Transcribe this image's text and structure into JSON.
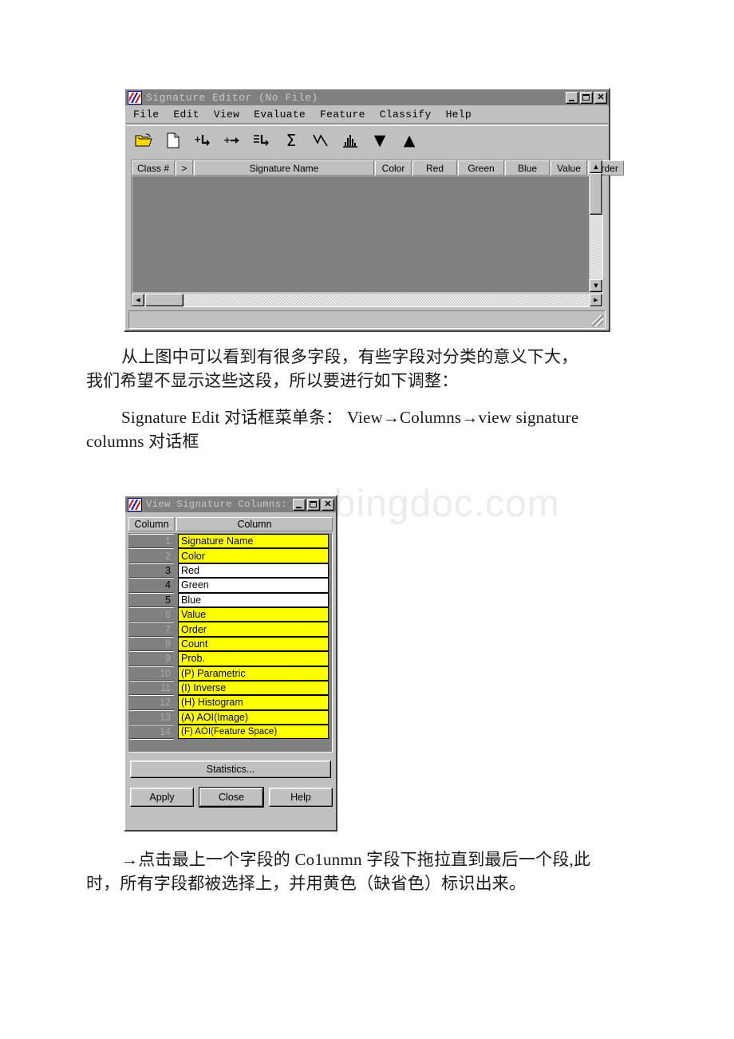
{
  "document": {
    "paragraphs": [
      {
        "id": "p1",
        "line1": "从上图中可以看到有很多字段，有些字段对分类的意义下大，",
        "line2": "我们希望不显示这些这段，所以要进行如下调整："
      },
      {
        "id": "p2",
        "line1": "Signature Edit 对话框菜单条： View→Columns→view signature",
        "line2": "columns 对话框"
      },
      {
        "id": "p3",
        "line1": "→点击最上一个字段的 Co1unmn 字段下拖拉直到最后一个段,此",
        "line2": "时，所有字段都被选择上，并用黄色（缺省色）标识出来。"
      }
    ],
    "watermark": "www.bingdoc.com"
  },
  "signature_editor": {
    "title": "Signature Editor (No File)",
    "icon": "app-icon",
    "titlebar_buttons": [
      {
        "name": "minimize-button",
        "glyph": "_"
      },
      {
        "name": "maximize-button",
        "glyph": "□"
      },
      {
        "name": "close-button",
        "glyph": "✕"
      }
    ],
    "menu": [
      "File",
      "Edit",
      "View",
      "Evaluate",
      "Feature",
      "Classify",
      "Help"
    ],
    "toolbar": [
      {
        "name": "open-folder-icon",
        "glyph": "📂"
      },
      {
        "name": "new-file-icon",
        "glyph": "🗋"
      },
      {
        "name": "add-signature-icon",
        "glyph": "+↳"
      },
      {
        "name": "merge-signature-icon",
        "glyph": "+→"
      },
      {
        "name": "list-signature-icon",
        "glyph": "≡↳"
      },
      {
        "name": "sigma-statistics-icon",
        "glyph": "Σ"
      },
      {
        "name": "mean-plot-icon",
        "glyph": "⋀"
      },
      {
        "name": "histogram-icon",
        "glyph": "▥"
      },
      {
        "name": "move-down-icon",
        "glyph": "▼"
      },
      {
        "name": "move-up-icon",
        "glyph": "▲"
      }
    ],
    "grid_headers": [
      "Class #",
      ">",
      "Signature Name",
      "Color",
      "Red",
      "Green",
      "Blue",
      "Value",
      "Order"
    ],
    "grid_rows": [],
    "scroll": {
      "up_arrow": "▲",
      "down_arrow": "▼",
      "left_arrow": "◄",
      "right_arrow": "►"
    }
  },
  "view_signature_columns": {
    "title": "View Signature Columns:",
    "titlebar_buttons": [
      {
        "name": "minimize-button",
        "glyph": "_"
      },
      {
        "name": "maximize-button",
        "glyph": "□"
      },
      {
        "name": "close-button",
        "glyph": "✕"
      }
    ],
    "headers": [
      "Column",
      "Column"
    ],
    "rows": [
      {
        "num": "1",
        "label": "Signature Name",
        "selected": true
      },
      {
        "num": "2",
        "label": "Color",
        "selected": true
      },
      {
        "num": "3",
        "label": "Red",
        "selected": false
      },
      {
        "num": "4",
        "label": "Green",
        "selected": false
      },
      {
        "num": "5",
        "label": "Blue",
        "selected": false
      },
      {
        "num": "6",
        "label": "Value",
        "selected": true
      },
      {
        "num": "7",
        "label": "Order",
        "selected": true
      },
      {
        "num": "8",
        "label": "Count",
        "selected": true
      },
      {
        "num": "9",
        "label": "Prob.",
        "selected": true
      },
      {
        "num": "10",
        "label": "(P) Parametric",
        "selected": true
      },
      {
        "num": "11",
        "label": "(I) Inverse",
        "selected": true
      },
      {
        "num": "12",
        "label": "(H) Histogram",
        "selected": true
      },
      {
        "num": "13",
        "label": "(A) AOI(Image)",
        "selected": true
      },
      {
        "num": "14",
        "label": "(F) AOI(Feature Space)",
        "selected": true
      }
    ],
    "statistics_button": "Statistics...",
    "apply_button": "Apply",
    "close_button": "Close",
    "help_button": "Help",
    "selection_color": "#ffff00"
  }
}
